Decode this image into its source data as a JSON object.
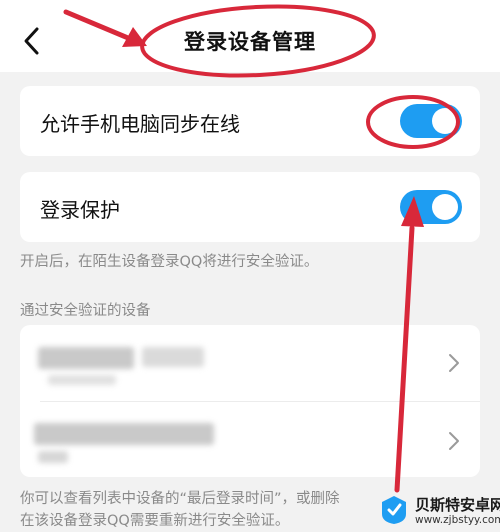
{
  "header": {
    "title": "登录设备管理",
    "back_icon": "chevron-left-icon"
  },
  "settings": {
    "sync_online": {
      "label": "允许手机电脑同步在线",
      "enabled": true
    },
    "login_protect": {
      "label": "登录保护",
      "enabled": true
    },
    "protect_caption": "开启后，在陌生设备登录QQ将进行安全验证。"
  },
  "devices": {
    "section_title": "通过安全验证的设备",
    "items_count_shown": 2
  },
  "footer": {
    "line1": "你可以查看列表中设备的“最后登录时间”，或删除",
    "line2": "在该设备登录QQ需要重新进行安全验证。"
  },
  "watermark": {
    "title": "贝斯特安卓网",
    "url": "www.zjbstyy.com"
  },
  "colors": {
    "accent": "#1e9df2",
    "annotation": "#d8283a",
    "background": "#f2f2f2"
  }
}
